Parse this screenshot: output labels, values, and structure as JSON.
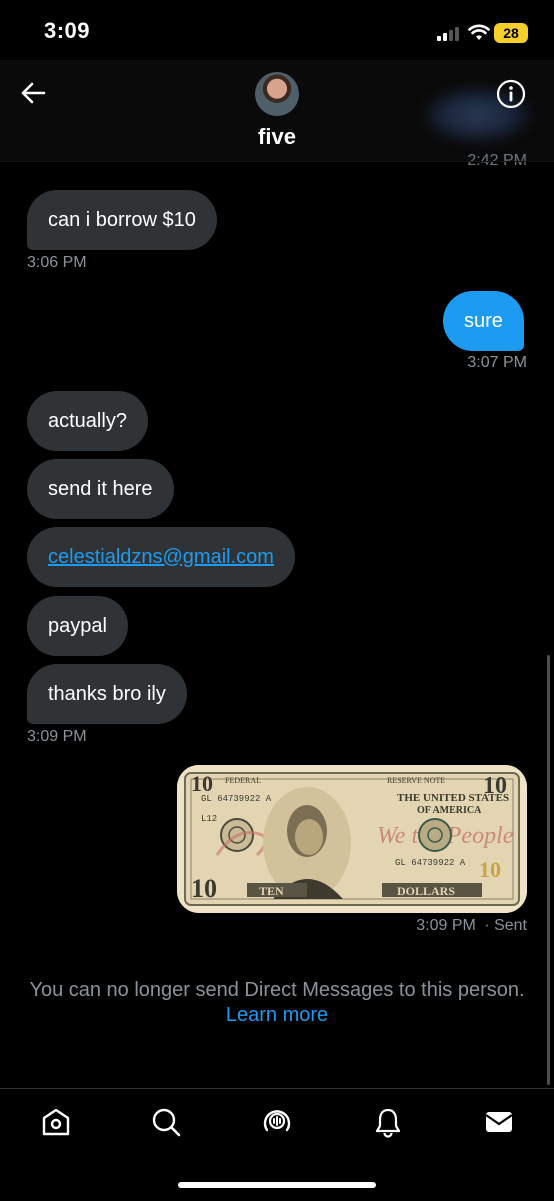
{
  "status_bar": {
    "time": "3:09",
    "battery": "28"
  },
  "header": {
    "name": "five",
    "avatar_icon": "user-avatar"
  },
  "conversation": {
    "previous_timestamp": "2:42 PM",
    "messages": [
      {
        "from": "them",
        "text": "can i borrow $10"
      },
      {
        "from": "me",
        "text": "sure"
      },
      {
        "from": "them",
        "text": "actually?"
      },
      {
        "from": "them",
        "text": "send it here"
      },
      {
        "from": "them",
        "text": "celestialdzns@gmail.com",
        "is_link": true
      },
      {
        "from": "them",
        "text": "paypal"
      },
      {
        "from": "them",
        "text": "thanks bro ily"
      }
    ],
    "timestamps": {
      "t1": "3:06 PM",
      "t2": "3:07 PM",
      "t3": "3:09 PM",
      "t4": "3:09 PM",
      "sent_label": "· Sent"
    },
    "attachment": {
      "type": "image",
      "bill": {
        "denomination": "10",
        "top_left": "FEDERAL",
        "top_right": "RESERVE NOTE",
        "header_line1": "THE UNITED STATES",
        "header_line2": "OF AMERICA",
        "serial": "GL 64739922 A",
        "plate": "L12",
        "watermark_text": "We the People",
        "bottom_left": "TEN",
        "bottom_right": "DOLLARS"
      }
    }
  },
  "footer_notice": {
    "text": "You can no longer send Direct Messages to this person.",
    "link": "Learn more"
  },
  "tabs": [
    {
      "name": "home-icon"
    },
    {
      "name": "search-icon"
    },
    {
      "name": "spaces-icon"
    },
    {
      "name": "notifications-icon"
    },
    {
      "name": "messages-icon"
    }
  ],
  "colors": {
    "accent": "#1d9bf0",
    "received_bubble": "#2f3336",
    "battery": "#f5cf2a",
    "muted": "#8b9299"
  }
}
